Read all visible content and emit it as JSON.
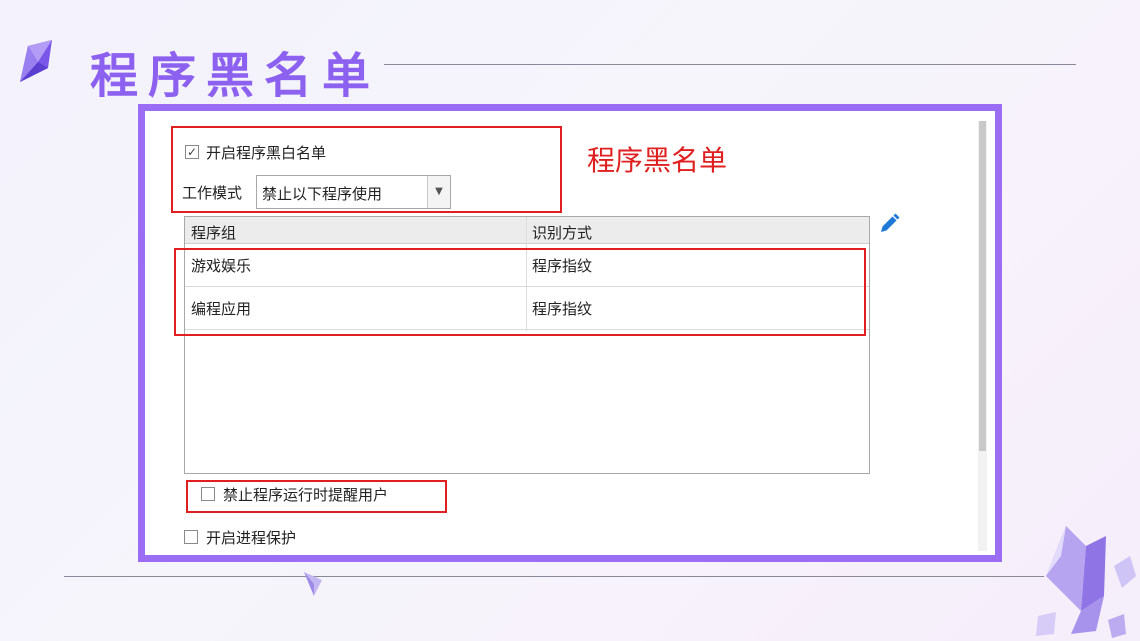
{
  "slide": {
    "title": "程序黑名单"
  },
  "dialog": {
    "enable_bw_list_label": "开启程序黑白名单",
    "enable_bw_list_checked": true,
    "work_mode_label": "工作模式",
    "work_mode_value": "禁止以下程序使用",
    "table": {
      "columns": [
        "程序组",
        "识别方式"
      ],
      "rows": [
        {
          "group": "游戏娱乐",
          "method": "程序指纹"
        },
        {
          "group": "编程应用",
          "method": "程序指纹"
        }
      ]
    },
    "notify_label": "禁止程序运行时提醒用户",
    "notify_checked": false,
    "process_protect_label": "开启进程保护",
    "process_protect_checked": false
  },
  "annotation": {
    "text": "程序黑名单"
  },
  "icons": {
    "gem": "crystal-gem-icon",
    "edit": "pencil-edit-icon",
    "dropdown": "chevron-down-icon"
  },
  "colors": {
    "accent": "#9b6cf4",
    "title": "#8c61f0",
    "highlight": "#e02020",
    "edit_icon": "#1e7ad6"
  }
}
